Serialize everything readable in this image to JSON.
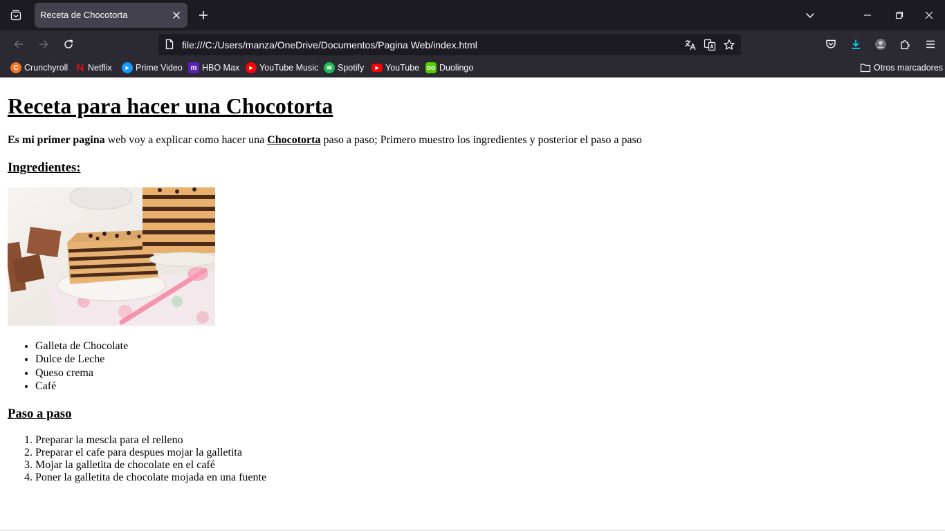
{
  "browser": {
    "tab_title": "Receta de Chocotorta",
    "url": "file:///C:/Users/manza/OneDrive/Documentos/Pagina Web/index.html",
    "accent_color": "#00ddff"
  },
  "bookmarks": {
    "items": [
      {
        "label": "Crunchyroll",
        "icon": "crunchyroll-icon",
        "color": "#f47521"
      },
      {
        "label": "Netflix",
        "icon": "netflix-icon",
        "color": "#e50914"
      },
      {
        "label": "Prime Video",
        "icon": "prime-video-icon",
        "color": "#1399ff"
      },
      {
        "label": "HBO Max",
        "icon": "hbo-max-icon",
        "color": "#5822b4"
      },
      {
        "label": "YouTube Music",
        "icon": "youtube-music-icon",
        "color": "#ff0000"
      },
      {
        "label": "Spotify",
        "icon": "spotify-icon",
        "color": "#1db954"
      },
      {
        "label": "YouTube",
        "icon": "youtube-icon",
        "color": "#ff0000"
      },
      {
        "label": "Duolingo",
        "icon": "duolingo-icon",
        "color": "#58cc02"
      }
    ],
    "other": "Otros marcadores"
  },
  "page": {
    "title": "Receta para hacer una Chocotorta",
    "intro": {
      "bold_start": "Es mi primer pagina",
      "text_1": " web voy a explicar como hacer una ",
      "link": "Chocotorta",
      "text_2": " paso a paso; Primero muestro los ingredientes y posterior el paso a paso"
    },
    "ingredients_heading": "Ingredientes:",
    "ingredients": [
      "Galleta de Chocolate",
      "Dulce de Leche",
      "Queso crema",
      "Café"
    ],
    "steps_heading": "Paso a paso",
    "steps": [
      "Preparar la mescla para el relleno",
      "Preparar el cafe para despues mojar la galletita",
      "Mojar la galletita de chocolate en el café",
      "Poner la galletita de chocolate mojada en una fuente"
    ]
  }
}
